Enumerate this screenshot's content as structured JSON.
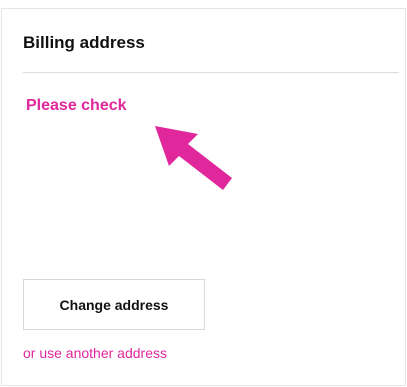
{
  "billing": {
    "title": "Billing address",
    "notice": "Please check",
    "change_button_label": "Change address",
    "alt_link_label": "or use another address"
  },
  "colors": {
    "accent": "#e0279b",
    "text": "#111111",
    "border": "#d9d9d9"
  },
  "icons": {
    "pointer": "arrow-icon"
  }
}
